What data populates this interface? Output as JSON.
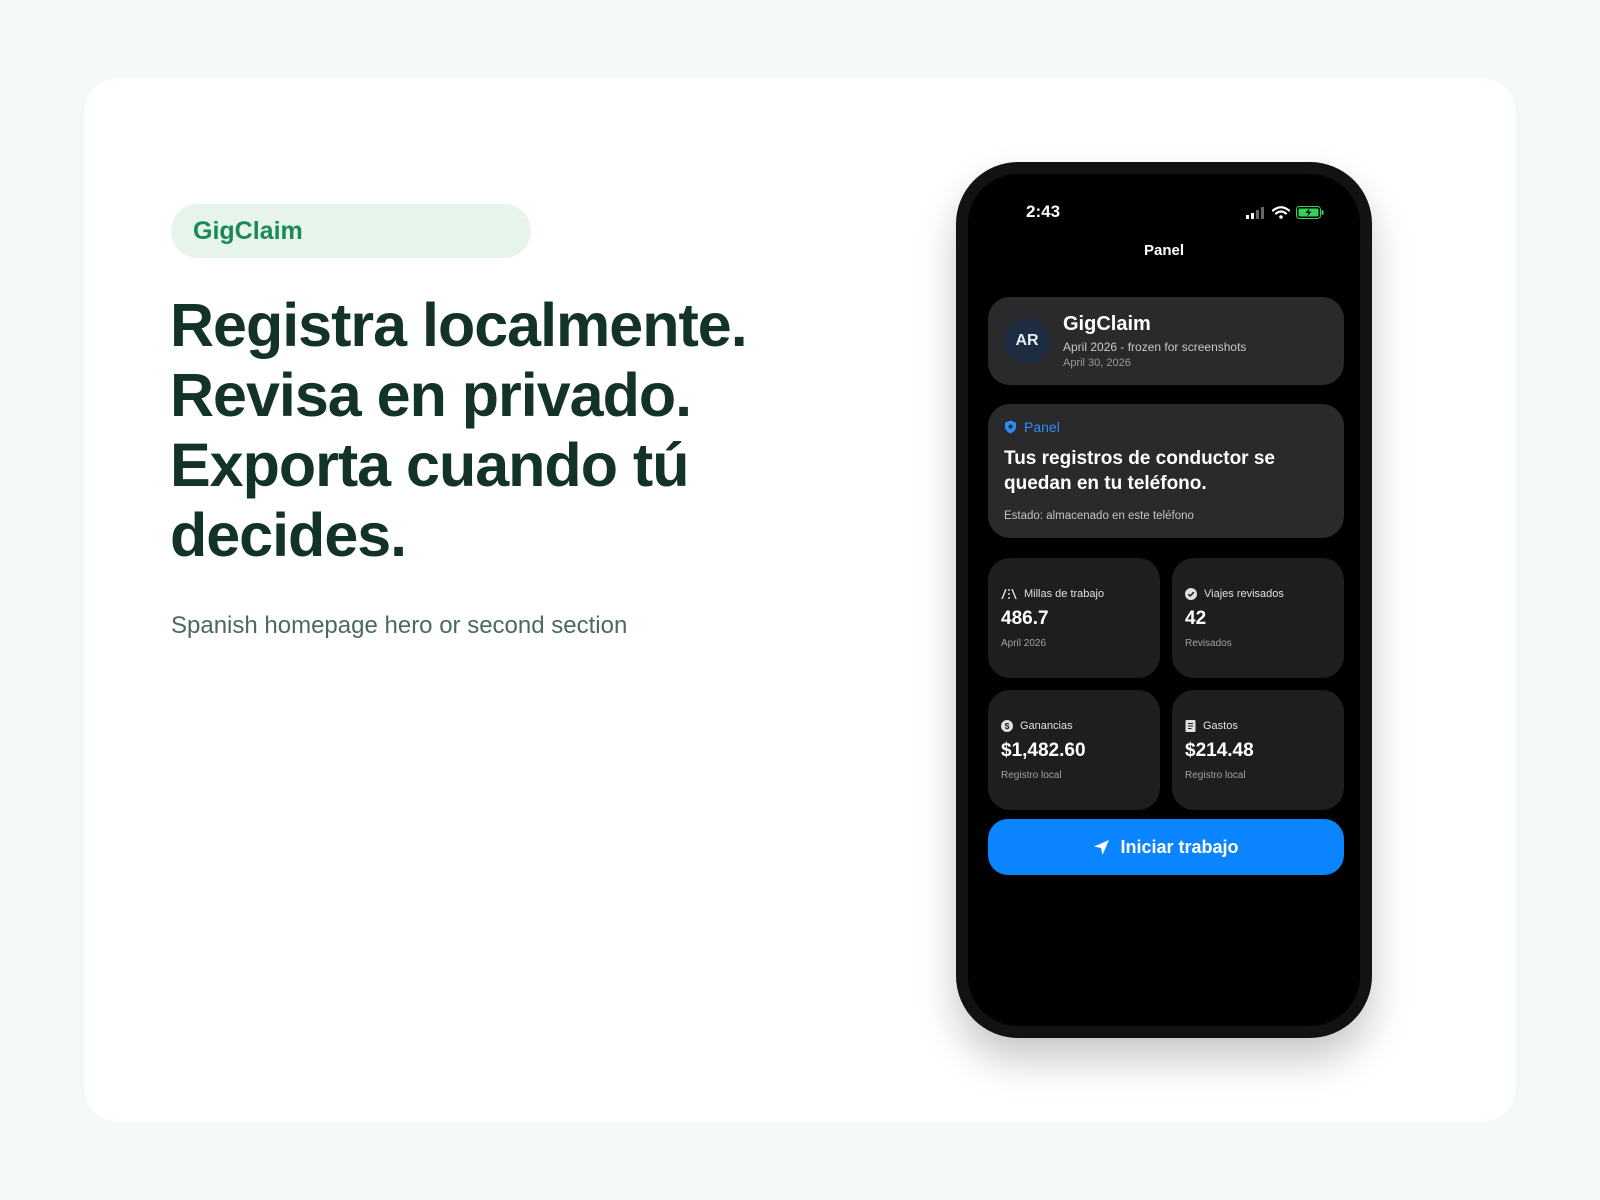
{
  "hero": {
    "badge": "GigClaim",
    "headline": [
      "Registra localmente.",
      "Revisa en privado.",
      "Exporta cuando tú",
      "decides."
    ],
    "subtitle": "Spanish homepage hero or second section"
  },
  "phone": {
    "status_bar": {
      "time": "2:43"
    },
    "nav_title": "Panel",
    "profile": {
      "initials": "AR",
      "name": "GigClaim",
      "subtitle": "April 2026 - frozen for screenshots",
      "date": "April 30, 2026"
    },
    "info_card": {
      "tag": "Panel",
      "title": "Tus registros de conductor se quedan en tu teléfono.",
      "status": "Estado: almacenado en este teléfono"
    },
    "stats": [
      {
        "label": "Millas de trabajo",
        "value": "486.7",
        "sub": "April 2026",
        "icon": "road-icon"
      },
      {
        "label": "Viajes revisados",
        "value": "42",
        "sub": "Revisados",
        "icon": "check-circle-icon"
      },
      {
        "label": "Ganancias",
        "value": "$1,482.60",
        "sub": "Registro local",
        "icon": "dollar-circle-icon"
      },
      {
        "label": "Gastos",
        "value": "$214.48",
        "sub": "Registro local",
        "icon": "receipt-icon"
      }
    ],
    "start_button": "Iniciar trabajo"
  },
  "colors": {
    "page_bg": "#f3f9f5",
    "brand_green": "#1a8a55",
    "headline": "#123326",
    "accent_blue": "#0a84ff"
  }
}
